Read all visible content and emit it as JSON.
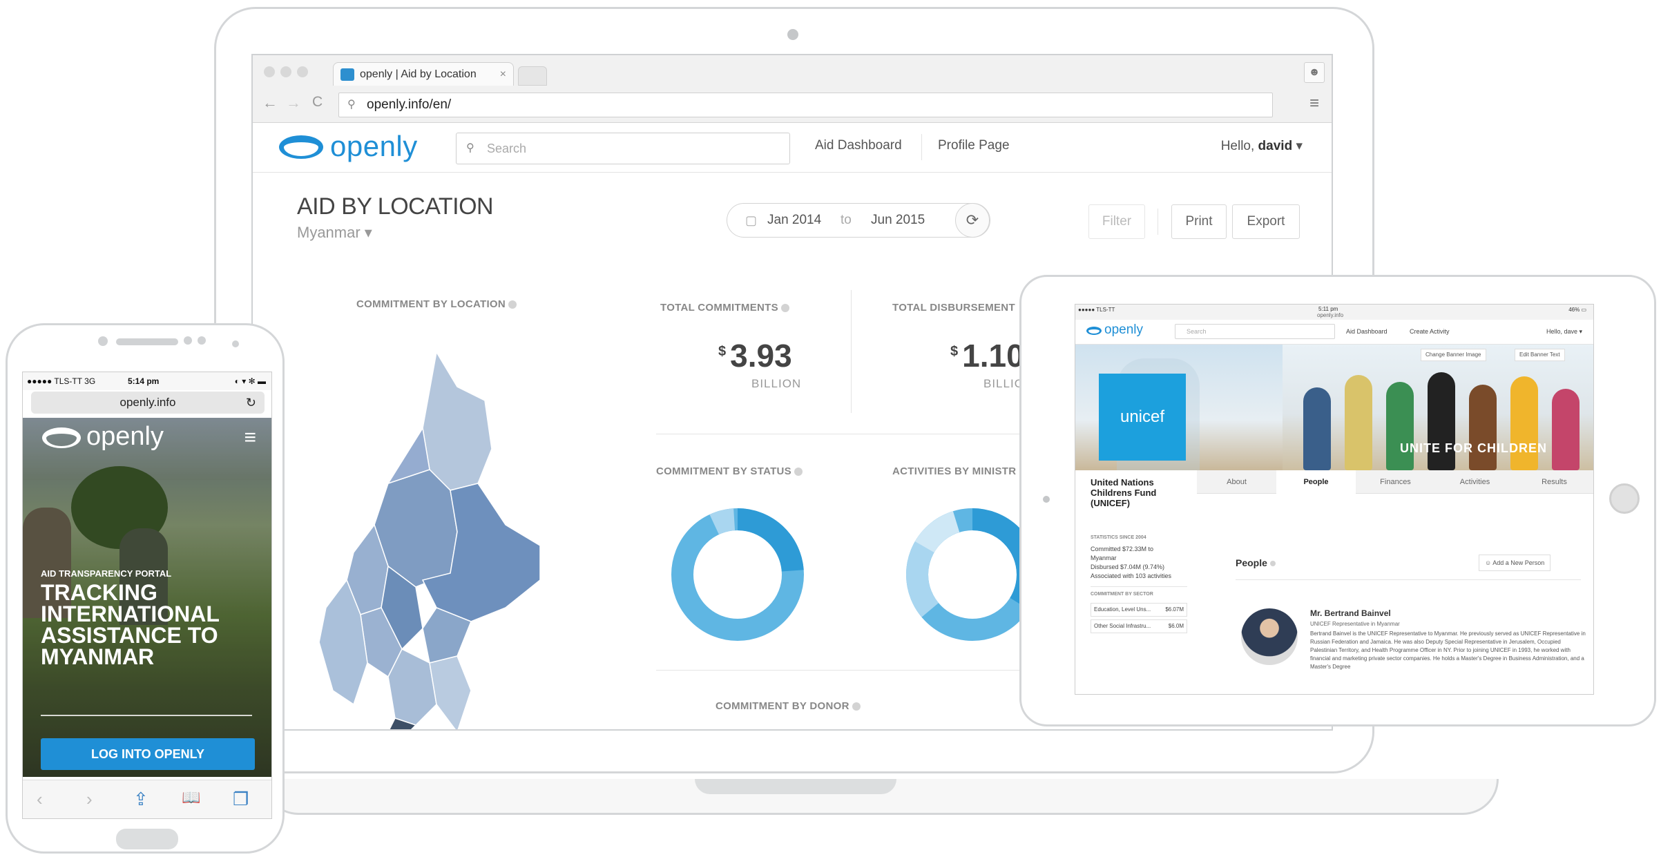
{
  "laptop": {
    "browser": {
      "tab_title": "openly | Aid by Location",
      "tab_close": "×",
      "url": "openly.info/en/",
      "back": "←",
      "forward": "→",
      "reload": "C",
      "menu": "≡"
    },
    "app": {
      "logo": "openly",
      "search_placeholder": "Search",
      "nav": [
        "Aid Dashboard",
        "Profile Page"
      ],
      "hello": "Hello,",
      "user": "david",
      "caret": "▾"
    },
    "dashboard": {
      "title": "AID BY LOCATION",
      "country": "Myanmar ▾",
      "date_from": "Jan 2014",
      "date_to_word": "to",
      "date_until": "Jun 2015",
      "buttons": {
        "filter": "Filter",
        "print": "Print",
        "export": "Export"
      },
      "sections": {
        "commitment_by_location": "COMMITMENT BY LOCATION",
        "total_commitments": "TOTAL COMMITMENTS",
        "total_disbursements": "TOTAL DISBURSEMENT",
        "commitment_by_status": "COMMITMENT BY STATUS",
        "activities_by_ministry": "ACTIVITIES BY MINISTR",
        "commitment_by_donor": "COMMITMENT BY DONOR"
      },
      "totals": [
        {
          "currency": "$",
          "value": "3.93",
          "unit": "BILLION"
        },
        {
          "currency": "$",
          "value": "1.10",
          "unit": "BILLIO"
        }
      ]
    }
  },
  "tablet": {
    "status": {
      "carrier": "●●●●● TLS-TT ",
      "time": "5:11 pm",
      "url": "openly.info",
      "battery": "46% ▭"
    },
    "app": {
      "logo": "openly",
      "search_placeholder": "Search",
      "nav": [
        "Aid Dashboard",
        "Create Activity"
      ],
      "hello": "Hello, dave ▾"
    },
    "banner": {
      "change_image": "Change Banner Image",
      "edit_text": "Edit Banner Text",
      "slogan": "UNITE FOR CHILDREN",
      "unicef": "unicef"
    },
    "org_name": "United Nations Childrens Fund (UNICEF)",
    "tabs": [
      "About",
      "People",
      "Finances",
      "Activities",
      "Results"
    ],
    "active_tab": "People",
    "stats_label": "STATISTICS SINCE 2004",
    "stats_lines": [
      "Committed $72.33M to",
      "Myanmar",
      "Disbursed $7.04M (9.74%)",
      "Associated with 103 activities"
    ],
    "sector_label": "COMMITMENT BY SECTOR",
    "sector_rows": [
      {
        "name": "Education, Level Uns...",
        "value": "$6.07M"
      },
      {
        "name": "Other Social Infrastru...",
        "value": "$6.0M"
      }
    ],
    "people_title": "People",
    "add_person": "Add a New Person",
    "person": {
      "name": "Mr. Bertrand Bainvel",
      "role": "UNICEF Representative in Myanmar",
      "bio": "Bertrand Bainvel is the UNICEF Representative to Myanmar. He previously served as UNICEF Representative in Russian Federation and Jamaica. He was also Deputy Special Representative in Jerusalem, Occupied Palestinian Territory, and Health Programme Officer in NY. Prior to joining UNICEF in 1993, he worked with financial and marketing private sector companies. He holds a Master's Degree in Business Administration, and a Master's Degree"
    }
  },
  "phone": {
    "status": {
      "carrier": "●●●●● TLS-TT  3G",
      "time": "5:14 pm",
      "icons": "◐ ▾ ✻ ▬"
    },
    "url": "openly.info",
    "reload": "↻",
    "logo": "openly",
    "menu": "≡",
    "kicker": "AID TRANSPARENCY PORTAL",
    "headline": "TRACKING INTERNATIONAL ASSISTANCE TO MYANMAR",
    "cta": "LOG INTO OPENLY",
    "toolbar": [
      "‹",
      "›",
      "⇪",
      "📖",
      "❐"
    ]
  },
  "colors": {
    "brand_blue": "#1f8fd6",
    "donut_dark": "#2e9bd6",
    "donut_mid": "#5fb6e3",
    "donut_light": "#a9d6f0",
    "map_fill": "#7f9fc4",
    "unicef_blue": "#1ca0dd"
  }
}
